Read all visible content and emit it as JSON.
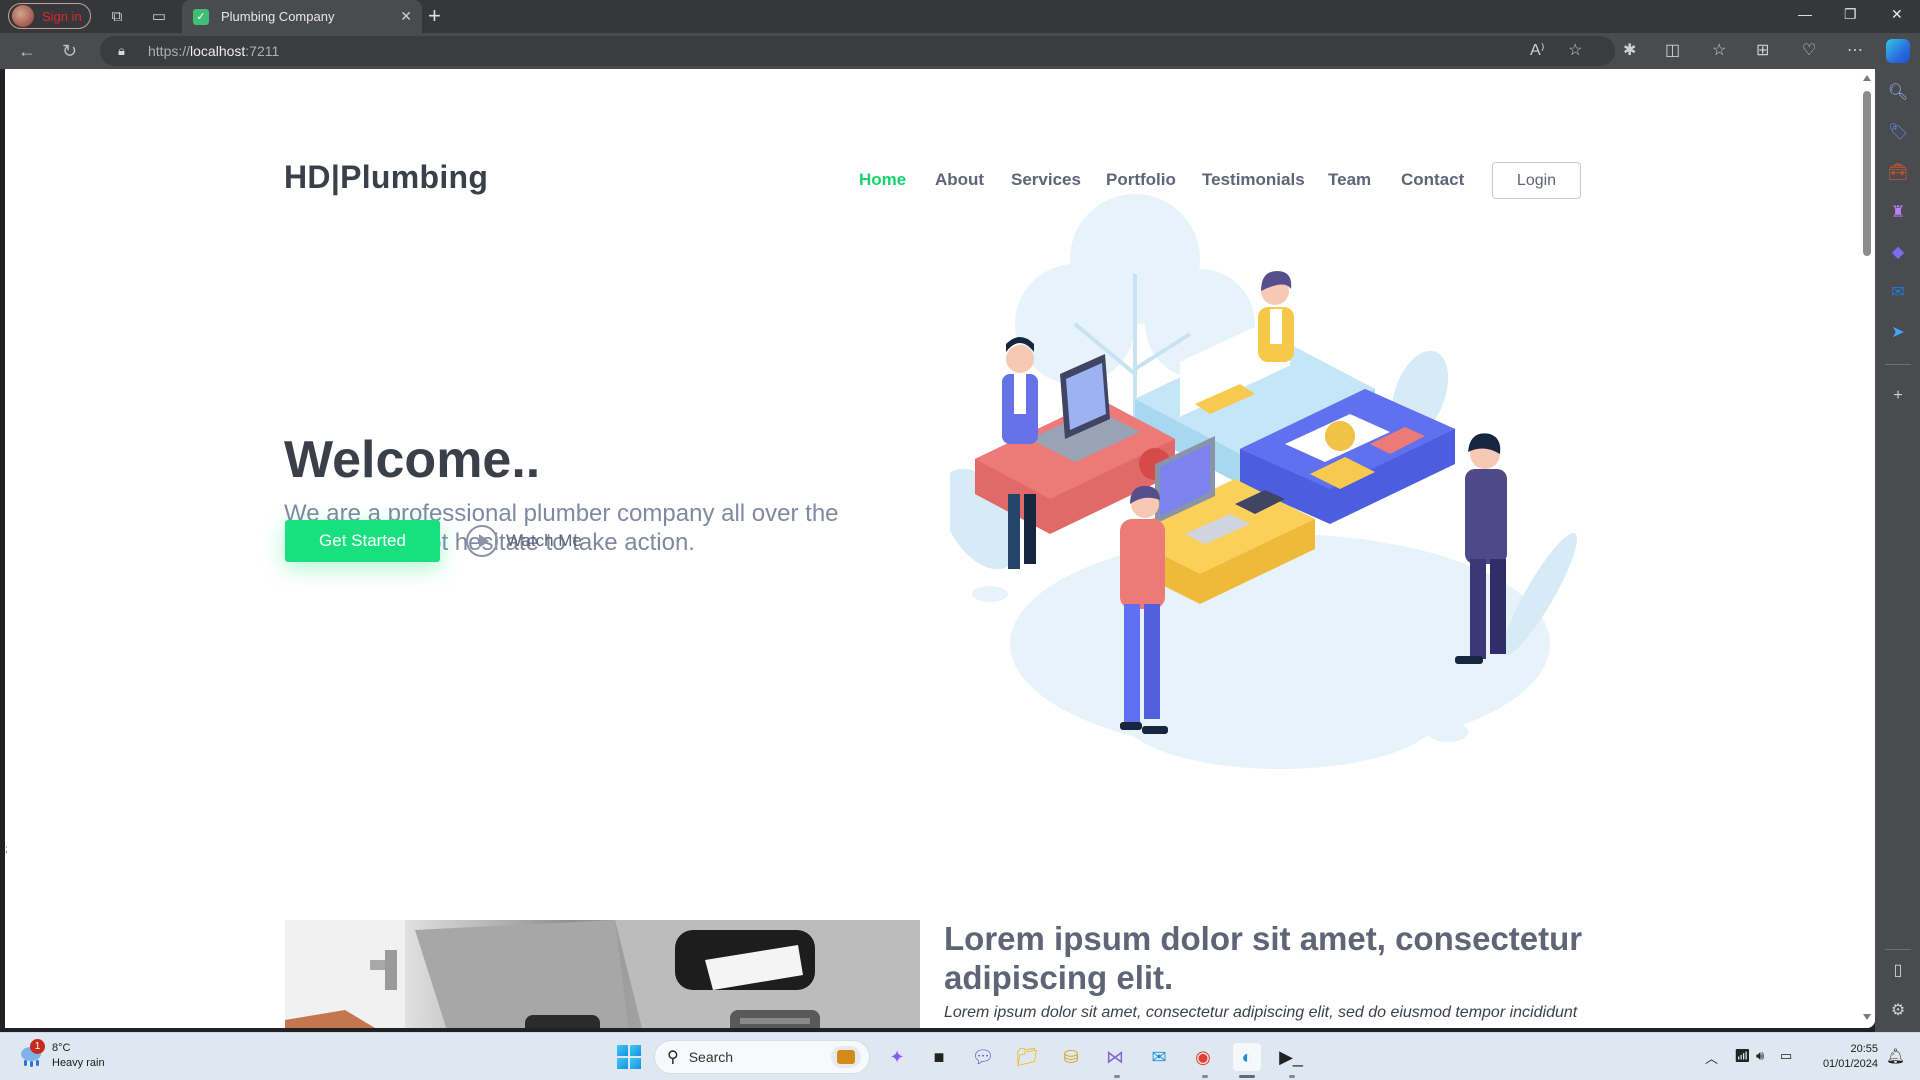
{
  "browser": {
    "profile_label": "Sign in",
    "tab_title": "Plumbing Company",
    "url_scheme": "https://",
    "url_host": "localhost",
    "url_port": ":7211"
  },
  "site": {
    "logo": "HD|Plumbing",
    "nav": [
      {
        "label": "Home",
        "active": true
      },
      {
        "label": "About",
        "active": false
      },
      {
        "label": "Services",
        "active": false
      },
      {
        "label": "Portfolio",
        "active": false
      },
      {
        "label": "Testimonials",
        "active": false
      },
      {
        "label": "Team",
        "active": false
      },
      {
        "label": "Contact",
        "active": false
      }
    ],
    "login_label": "Login",
    "hero": {
      "title": "Welcome..",
      "subtitle": "We are a professional plumber company all over the London. Do not hesitate to take action.",
      "cta_label": "Get Started",
      "watch_label": "Watch Me"
    },
    "about": {
      "title": "Lorem ipsum dolor sit amet, consectetur adipiscing elit.",
      "text": "Lorem ipsum dolor sit amet, consectetur adipiscing elit, sed do eiusmod tempor incididunt"
    },
    "colors": {
      "accent": "#18d26e",
      "heading": "#3b3f4a",
      "muted": "#8089a0"
    }
  },
  "taskbar": {
    "weather_temp": "8°C",
    "weather_desc": "Heavy rain",
    "weather_badge": "1",
    "search_label": "Search",
    "time": "20:55",
    "date": "01/01/2024"
  }
}
